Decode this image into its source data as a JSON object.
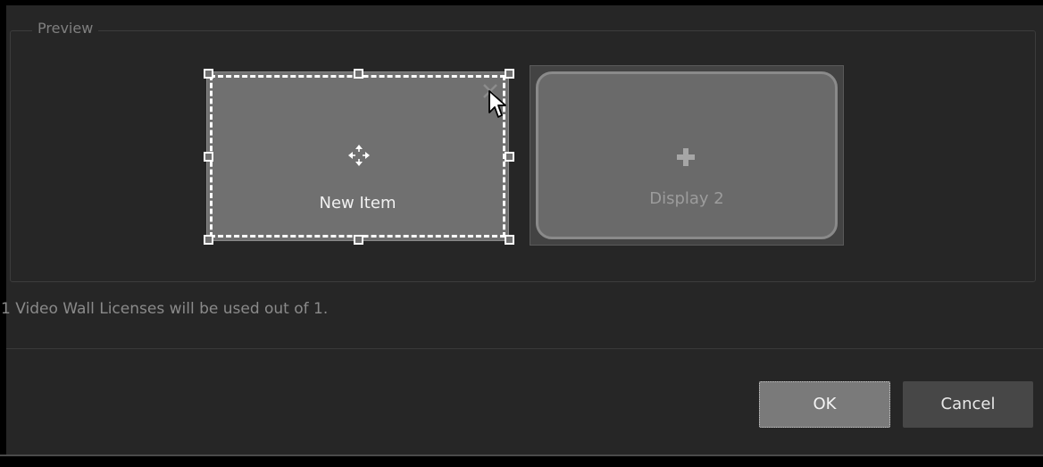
{
  "preview": {
    "title": "Preview",
    "screens": [
      {
        "label": "New Item",
        "state": "selected"
      },
      {
        "label": "Display 2",
        "state": "available"
      }
    ]
  },
  "license_text": "1 Video Wall Licenses will be used out of 1.",
  "buttons": {
    "ok_label": "OK",
    "cancel_label": "Cancel"
  },
  "icons": {
    "move": "move-icon",
    "close": "close-icon",
    "add": "plus-icon",
    "cursor": "mouse-cursor-icon"
  },
  "colors": {
    "dialog_background": "#262626",
    "selected_screen": "#707070",
    "available_screen": "#6a6a6a",
    "ok_button": "#7a7a7a",
    "cancel_button": "#474747"
  }
}
